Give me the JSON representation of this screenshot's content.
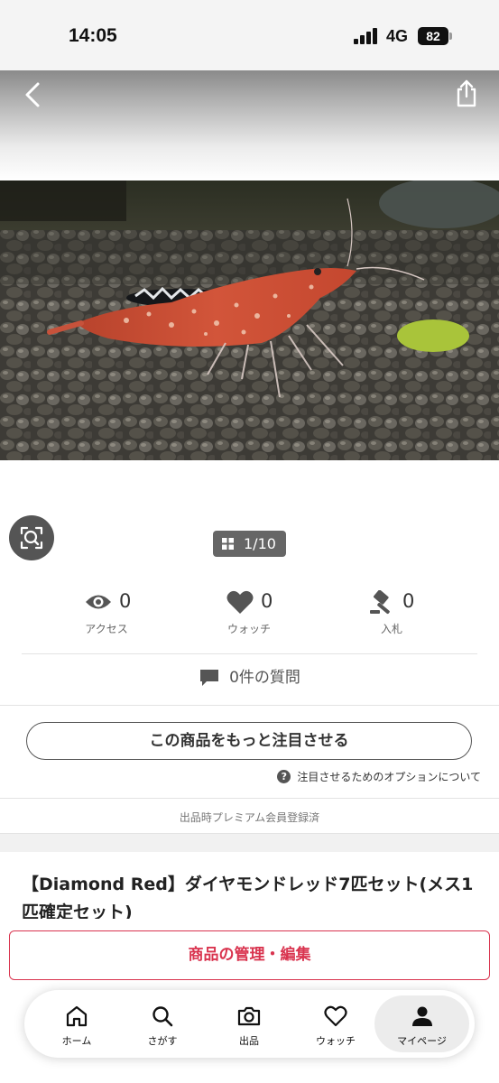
{
  "status_bar": {
    "time": "14:05",
    "network": "4G",
    "battery": "82"
  },
  "gallery": {
    "counter": "1/10"
  },
  "stats": [
    {
      "label": "アクセス",
      "value": "0",
      "icon": "eye-icon"
    },
    {
      "label": "ウォッチ",
      "value": "0",
      "icon": "heart-icon"
    },
    {
      "label": "入札",
      "value": "0",
      "icon": "gavel-icon"
    }
  ],
  "questions_label": "0件の質問",
  "promote_button": "この商品をもっと注目させる",
  "promote_options_link": "注目させるためのオプションについて",
  "premium_note": "出品時プレミアム会員登録済",
  "item_title": "【Diamond Red】ダイヤモンドレッド7匹セット(メス1匹確定セット)",
  "manage_button": "商品の管理・編集",
  "tabbar": [
    {
      "label": "ホーム",
      "icon": "home-icon",
      "active": false
    },
    {
      "label": "さがす",
      "icon": "search-icon",
      "active": false
    },
    {
      "label": "出品",
      "icon": "camera-icon",
      "active": false
    },
    {
      "label": "ウォッチ",
      "icon": "heart-icon",
      "active": false
    },
    {
      "label": "マイページ",
      "icon": "person-icon",
      "active": true
    }
  ],
  "colors": {
    "accent": "#d9344f",
    "icon_gray": "#555555"
  }
}
